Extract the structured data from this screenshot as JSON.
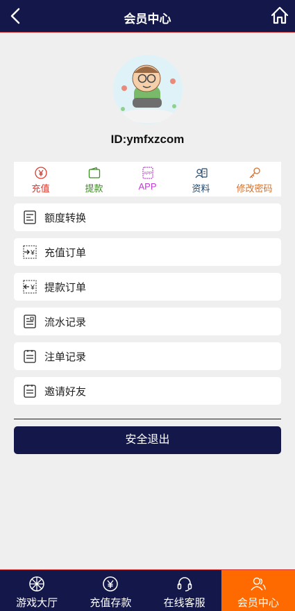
{
  "header": {
    "title": "会员中心"
  },
  "profile": {
    "user_id": "ID:ymfxzcom"
  },
  "quick_actions": [
    {
      "label": "充值",
      "color": "#e0362c",
      "icon": "yen-circle-icon"
    },
    {
      "label": "提款",
      "color": "#3b8a22",
      "icon": "wallet-icon"
    },
    {
      "label": "APP",
      "color": "#c23ad6",
      "icon": "app-icon"
    },
    {
      "label": "资料",
      "color": "#21466b",
      "icon": "profile-card-icon"
    },
    {
      "label": "修改密码",
      "color": "#d6702a",
      "icon": "key-icon"
    }
  ],
  "menu": [
    {
      "label": "额度转换",
      "icon": "receipt-icon"
    },
    {
      "label": "充值订单",
      "icon": "deposit-order-icon"
    },
    {
      "label": "提款订单",
      "icon": "withdraw-order-icon"
    },
    {
      "label": "流水记录",
      "icon": "record-icon"
    },
    {
      "label": "注单记录",
      "icon": "clipboard-icon"
    },
    {
      "label": "邀请好友",
      "icon": "invite-icon"
    }
  ],
  "logout_label": "安全退出",
  "tabbar": [
    {
      "label": "游戏大厅",
      "icon": "wheel-icon",
      "active": false
    },
    {
      "label": "充值存款",
      "icon": "yen-circle-icon",
      "active": false
    },
    {
      "label": "在线客服",
      "icon": "headset-icon",
      "active": false
    },
    {
      "label": "会员中心",
      "icon": "user-group-icon",
      "active": true
    }
  ],
  "colors": {
    "navy": "#14174a",
    "accent": "#ff6a00",
    "background": "#efefef"
  }
}
